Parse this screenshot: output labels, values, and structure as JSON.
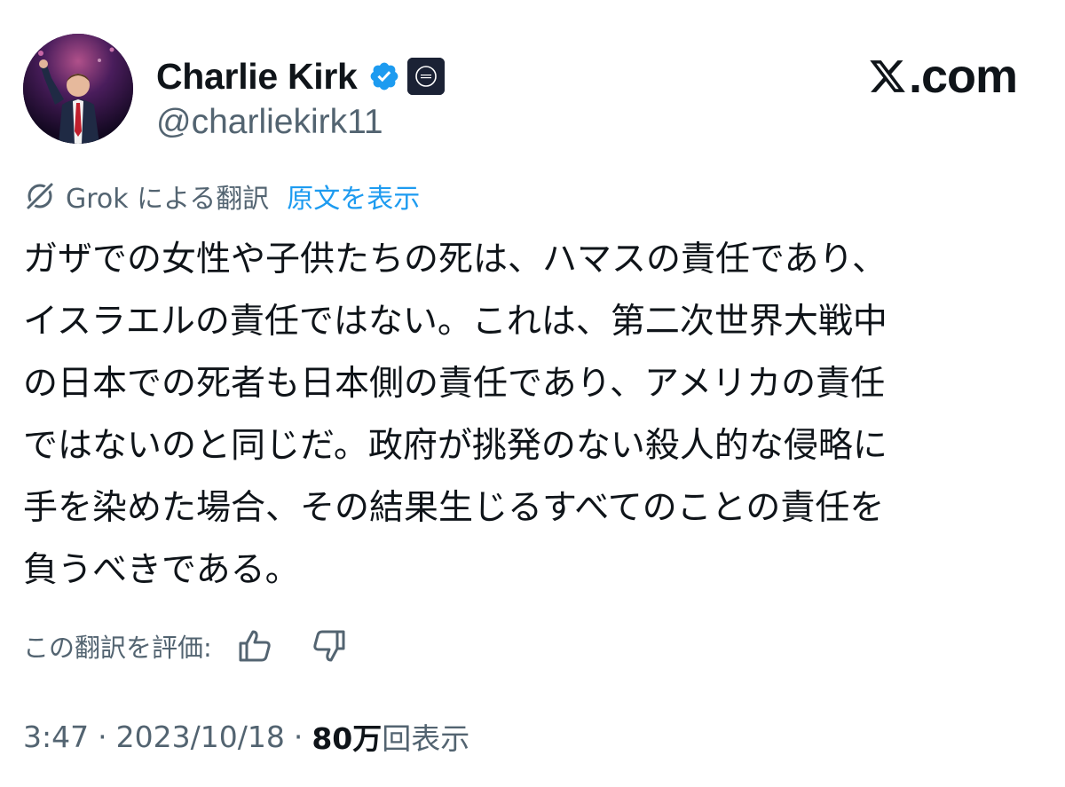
{
  "author": {
    "name": "Charlie Kirk",
    "handle": "@charliekirk11",
    "verified": true,
    "verified_color": "#1d9bf0",
    "affiliate_badge_color": "#1b2235"
  },
  "brand": {
    "site": ".com",
    "logo_icon": "x-logo-icon"
  },
  "translation": {
    "label": "Grok による翻訳",
    "show_original": "原文を表示",
    "link_color": "#1d9bf0"
  },
  "post": {
    "lines": [
      "ガザでの女性や子供たちの死は、ハマスの責任であり、",
      "イスラエルの責任ではない。これは、第二次世界大戦中",
      "の日本での死者も日本側の責任であり、アメリカの責任",
      "ではないのと同じだ。政府が挑発のない殺人的な侵略に",
      "手を染めた場合、その結果生じるすべてのことの責任を",
      "負うべきである。"
    ]
  },
  "rating": {
    "label": "この翻訳を評価:",
    "thumbs_up_icon": "thumbs-up-icon",
    "thumbs_down_icon": "thumbs-down-icon"
  },
  "meta": {
    "time": "3:47",
    "separator": "·",
    "date": "2023/10/18",
    "views_count": "80万",
    "views_label": "回表示"
  },
  "colors": {
    "text_primary": "#0f1419",
    "text_secondary": "#536471",
    "background": "#ffffff"
  }
}
